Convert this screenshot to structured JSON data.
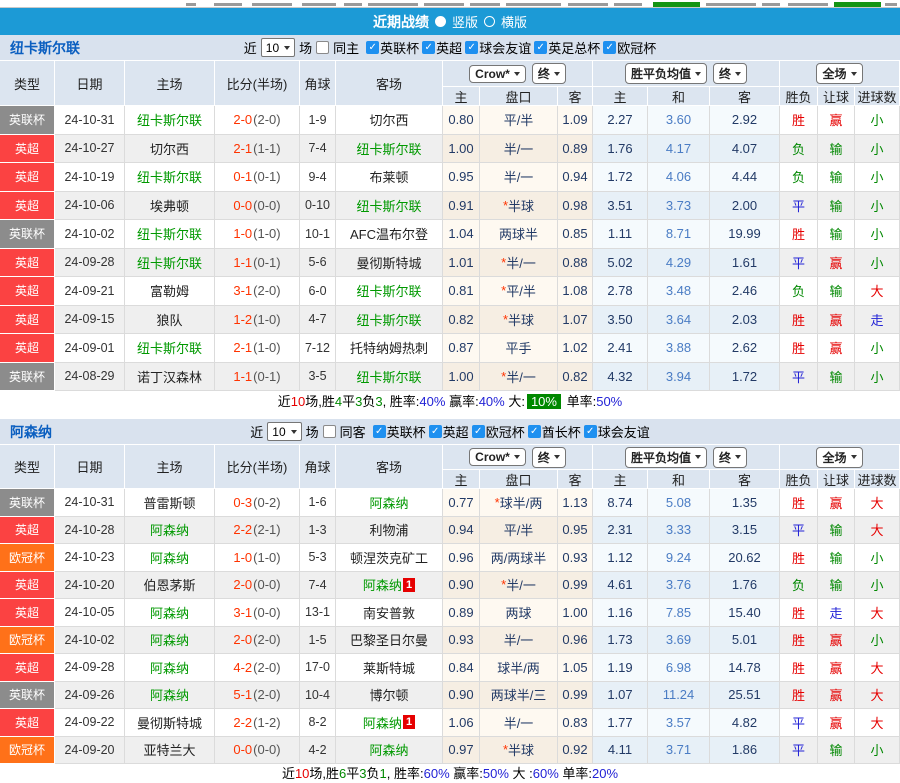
{
  "title_bar": {
    "title": "近期战绩",
    "radios": [
      {
        "label": "竖版",
        "selected": true
      },
      {
        "label": "横版",
        "selected": false
      }
    ]
  },
  "labels": {
    "near": "近",
    "matches": "场"
  },
  "columns": {
    "type": "类型",
    "date": "日期",
    "home": "主场",
    "score": "比分(半场)",
    "corner": "角球",
    "away": "客场",
    "sub": [
      "主",
      "盘口",
      "客",
      "主",
      "和",
      "客",
      "胜负",
      "让球",
      "进球数"
    ]
  },
  "dropdowns": {
    "crow": "Crow*",
    "final": "终",
    "mean": "胜平负均值",
    "scope": "全场"
  },
  "colors": {
    "title_bar_bg": "#1C9AD6",
    "section_bg": "#D9E2EE",
    "header_bg": "#DCE5F0",
    "league": {
      "英超": "#FB4242",
      "英联杯": "#8C8C8C",
      "欧冠杯": "#FF7119"
    },
    "win_red": "#E60000",
    "draw_blue": "#2222D6",
    "lose_green": "#008800",
    "team_green": "#009900",
    "score_red": "#FF3300",
    "highlight_green": "#008800",
    "checkbox_blue": "#1E90F0"
  },
  "sections": [
    {
      "team": "纽卡斯尔联",
      "count": "10",
      "same_label": "同主",
      "same_checked": false,
      "leagues": [
        "英联杯",
        "英超",
        "球会友谊",
        "英足总杯",
        "欧冠杯"
      ],
      "rows": [
        {
          "league": "英联杯",
          "date": "24-10-31",
          "home": "纽卡斯尔联",
          "home_is_team": true,
          "home_badge": "",
          "score": "2-0",
          "half": "(2-0)",
          "corner": "1-9",
          "away": "切尔西",
          "away_is_team": false,
          "away_badge": "",
          "ch": "0.80",
          "hcap": "平/半",
          "ca": "1.09",
          "mh": "2.27",
          "md": "3.60",
          "ma": "2.92",
          "res": "胜",
          "hres": "赢",
          "goal": "小"
        },
        {
          "league": "英超",
          "date": "24-10-27",
          "home": "切尔西",
          "home_is_team": false,
          "home_badge": "",
          "score": "2-1",
          "half": "(1-1)",
          "corner": "7-4",
          "away": "纽卡斯尔联",
          "away_is_team": true,
          "away_badge": "",
          "ch": "1.00",
          "hcap": "半/一",
          "ca": "0.89",
          "mh": "1.76",
          "md": "4.17",
          "ma": "4.07",
          "res": "负",
          "hres": "输",
          "goal": "小"
        },
        {
          "league": "英超",
          "date": "24-10-19",
          "home": "纽卡斯尔联",
          "home_is_team": true,
          "home_badge": "",
          "score": "0-1",
          "half": "(0-1)",
          "corner": "9-4",
          "away": "布莱顿",
          "away_is_team": false,
          "away_badge": "",
          "ch": "0.95",
          "hcap": "半/一",
          "ca": "0.94",
          "mh": "1.72",
          "md": "4.06",
          "ma": "4.44",
          "res": "负",
          "hres": "输",
          "goal": "小"
        },
        {
          "league": "英超",
          "date": "24-10-06",
          "home": "埃弗顿",
          "home_is_team": false,
          "home_badge": "",
          "score": "0-0",
          "half": "(0-0)",
          "corner": "0-10",
          "away": "纽卡斯尔联",
          "away_is_team": true,
          "away_badge": "",
          "ch": "0.91",
          "hcap": "*半球",
          "ca": "0.98",
          "mh": "3.51",
          "md": "3.73",
          "ma": "2.00",
          "res": "平",
          "hres": "输",
          "goal": "小"
        },
        {
          "league": "英联杯",
          "date": "24-10-02",
          "home": "纽卡斯尔联",
          "home_is_team": true,
          "home_badge": "",
          "score": "1-0",
          "half": "(1-0)",
          "corner": "10-1",
          "away": "AFC温布尔登",
          "away_is_team": false,
          "away_badge": "",
          "ch": "1.04",
          "hcap": "两球半",
          "ca": "0.85",
          "mh": "1.11",
          "md": "8.71",
          "ma": "19.99",
          "res": "胜",
          "hres": "输",
          "goal": "小"
        },
        {
          "league": "英超",
          "date": "24-09-28",
          "home": "纽卡斯尔联",
          "home_is_team": true,
          "home_badge": "",
          "score": "1-1",
          "half": "(0-1)",
          "corner": "5-6",
          "away": "曼彻斯特城",
          "away_is_team": false,
          "away_badge": "",
          "ch": "1.01",
          "hcap": "*半/一",
          "ca": "0.88",
          "mh": "5.02",
          "md": "4.29",
          "ma": "1.61",
          "res": "平",
          "hres": "赢",
          "goal": "小"
        },
        {
          "league": "英超",
          "date": "24-09-21",
          "home": "富勒姆",
          "home_is_team": false,
          "home_badge": "",
          "score": "3-1",
          "half": "(2-0)",
          "corner": "6-0",
          "away": "纽卡斯尔联",
          "away_is_team": true,
          "away_badge": "",
          "ch": "0.81",
          "hcap": "*平/半",
          "ca": "1.08",
          "mh": "2.78",
          "md": "3.48",
          "ma": "2.46",
          "res": "负",
          "hres": "输",
          "goal": "大"
        },
        {
          "league": "英超",
          "date": "24-09-15",
          "home": "狼队",
          "home_is_team": false,
          "home_badge": "",
          "score": "1-2",
          "half": "(1-0)",
          "corner": "4-7",
          "away": "纽卡斯尔联",
          "away_is_team": true,
          "away_badge": "",
          "ch": "0.82",
          "hcap": "*半球",
          "ca": "1.07",
          "mh": "3.50",
          "md": "3.64",
          "ma": "2.03",
          "res": "胜",
          "hres": "赢",
          "goal": "走"
        },
        {
          "league": "英超",
          "date": "24-09-01",
          "home": "纽卡斯尔联",
          "home_is_team": true,
          "home_badge": "",
          "score": "2-1",
          "half": "(1-0)",
          "corner": "7-12",
          "away": "托特纳姆热刺",
          "away_is_team": false,
          "away_badge": "",
          "ch": "0.87",
          "hcap": "平手",
          "ca": "1.02",
          "mh": "2.41",
          "md": "3.88",
          "ma": "2.62",
          "res": "胜",
          "hres": "赢",
          "goal": "小"
        },
        {
          "league": "英联杯",
          "date": "24-08-29",
          "home": "诺丁汉森林",
          "home_is_team": false,
          "home_badge": "",
          "score": "1-1",
          "half": "(0-1)",
          "corner": "3-5",
          "away": "纽卡斯尔联",
          "away_is_team": true,
          "away_badge": "",
          "ch": "1.00",
          "hcap": "*半/一",
          "ca": "0.82",
          "mh": "4.32",
          "md": "3.94",
          "ma": "1.72",
          "res": "平",
          "hres": "输",
          "goal": "小"
        }
      ],
      "summary": [
        {
          "t": "近",
          "c": "sk"
        },
        {
          "t": "10",
          "c": "sr"
        },
        {
          "t": "场,胜",
          "c": "sk"
        },
        {
          "t": "4",
          "c": "sg"
        },
        {
          "t": "平",
          "c": "sk"
        },
        {
          "t": "3",
          "c": "sg"
        },
        {
          "t": "负",
          "c": "sk"
        },
        {
          "t": "3",
          "c": "sg"
        },
        {
          "t": ", 胜率:",
          "c": "sk"
        },
        {
          "t": "40%",
          "c": "sb"
        },
        {
          "t": " 赢率:",
          "c": "sk"
        },
        {
          "t": "40%",
          "c": "sb"
        },
        {
          "t": " 大:",
          "c": "sk"
        },
        {
          "t": "10%",
          "c": "shl"
        },
        {
          "t": " 单率:",
          "c": "sk"
        },
        {
          "t": "50%",
          "c": "sb"
        }
      ]
    },
    {
      "team": "阿森纳",
      "count": "10",
      "same_label": "同客",
      "same_checked": false,
      "leagues": [
        "英联杯",
        "英超",
        "欧冠杯",
        "酋长杯",
        "球会友谊"
      ],
      "rows": [
        {
          "league": "英联杯",
          "date": "24-10-31",
          "home": "普雷斯顿",
          "home_is_team": false,
          "home_badge": "",
          "score": "0-3",
          "half": "(0-2)",
          "corner": "1-6",
          "away": "阿森纳",
          "away_is_team": true,
          "away_badge": "",
          "ch": "0.77",
          "hcap": "*球半/两",
          "ca": "1.13",
          "mh": "8.74",
          "md": "5.08",
          "ma": "1.35",
          "res": "胜",
          "hres": "赢",
          "goal": "大"
        },
        {
          "league": "英超",
          "date": "24-10-28",
          "home": "阿森纳",
          "home_is_team": true,
          "home_badge": "",
          "score": "2-2",
          "half": "(2-1)",
          "corner": "1-3",
          "away": "利物浦",
          "away_is_team": false,
          "away_badge": "",
          "ch": "0.94",
          "hcap": "平/半",
          "ca": "0.95",
          "mh": "2.31",
          "md": "3.33",
          "ma": "3.15",
          "res": "平",
          "hres": "输",
          "goal": "大"
        },
        {
          "league": "欧冠杯",
          "date": "24-10-23",
          "home": "阿森纳",
          "home_is_team": true,
          "home_badge": "",
          "score": "1-0",
          "half": "(1-0)",
          "corner": "5-3",
          "away": "顿涅茨克矿工",
          "away_is_team": false,
          "away_badge": "",
          "ch": "0.96",
          "hcap": "两/两球半",
          "ca": "0.93",
          "mh": "1.12",
          "md": "9.24",
          "ma": "20.62",
          "res": "胜",
          "hres": "输",
          "goal": "小"
        },
        {
          "league": "英超",
          "date": "24-10-20",
          "home": "伯恩茅斯",
          "home_is_team": false,
          "home_badge": "",
          "score": "2-0",
          "half": "(0-0)",
          "corner": "7-4",
          "away": "阿森纳",
          "away_is_team": true,
          "away_badge": "1",
          "ch": "0.90",
          "hcap": "*半/一",
          "ca": "0.99",
          "mh": "4.61",
          "md": "3.76",
          "ma": "1.76",
          "res": "负",
          "hres": "输",
          "goal": "小"
        },
        {
          "league": "英超",
          "date": "24-10-05",
          "home": "阿森纳",
          "home_is_team": true,
          "home_badge": "",
          "score": "3-1",
          "half": "(0-0)",
          "corner": "13-1",
          "away": "南安普敦",
          "away_is_team": false,
          "away_badge": "",
          "ch": "0.89",
          "hcap": "两球",
          "ca": "1.00",
          "mh": "1.16",
          "md": "7.85",
          "ma": "15.40",
          "res": "胜",
          "hres": "走",
          "goal": "大"
        },
        {
          "league": "欧冠杯",
          "date": "24-10-02",
          "home": "阿森纳",
          "home_is_team": true,
          "home_badge": "",
          "score": "2-0",
          "half": "(2-0)",
          "corner": "1-5",
          "away": "巴黎圣日尔曼",
          "away_is_team": false,
          "away_badge": "",
          "ch": "0.93",
          "hcap": "半/一",
          "ca": "0.96",
          "mh": "1.73",
          "md": "3.69",
          "ma": "5.01",
          "res": "胜",
          "hres": "赢",
          "goal": "小"
        },
        {
          "league": "英超",
          "date": "24-09-28",
          "home": "阿森纳",
          "home_is_team": true,
          "home_badge": "",
          "score": "4-2",
          "half": "(2-0)",
          "corner": "17-0",
          "away": "莱斯特城",
          "away_is_team": false,
          "away_badge": "",
          "ch": "0.84",
          "hcap": "球半/两",
          "ca": "1.05",
          "mh": "1.19",
          "md": "6.98",
          "ma": "14.78",
          "res": "胜",
          "hres": "赢",
          "goal": "大"
        },
        {
          "league": "英联杯",
          "date": "24-09-26",
          "home": "阿森纳",
          "home_is_team": true,
          "home_badge": "",
          "score": "5-1",
          "half": "(2-0)",
          "corner": "10-4",
          "away": "博尔顿",
          "away_is_team": false,
          "away_badge": "",
          "ch": "0.90",
          "hcap": "两球半/三",
          "ca": "0.99",
          "mh": "1.07",
          "md": "11.24",
          "ma": "25.51",
          "res": "胜",
          "hres": "赢",
          "goal": "大"
        },
        {
          "league": "英超",
          "date": "24-09-22",
          "home": "曼彻斯特城",
          "home_is_team": false,
          "home_badge": "",
          "score": "2-2",
          "half": "(1-2)",
          "corner": "8-2",
          "away": "阿森纳",
          "away_is_team": true,
          "away_badge": "1",
          "ch": "1.06",
          "hcap": "半/一",
          "ca": "0.83",
          "mh": "1.77",
          "md": "3.57",
          "ma": "4.82",
          "res": "平",
          "hres": "赢",
          "goal": "大"
        },
        {
          "league": "欧冠杯",
          "date": "24-09-20",
          "home": "亚特兰大",
          "home_is_team": false,
          "home_badge": "",
          "score": "0-0",
          "half": "(0-0)",
          "corner": "4-2",
          "away": "阿森纳",
          "away_is_team": true,
          "away_badge": "",
          "ch": "0.97",
          "hcap": "*半球",
          "ca": "0.92",
          "mh": "4.11",
          "md": "3.71",
          "ma": "1.86",
          "res": "平",
          "hres": "输",
          "goal": "小"
        }
      ],
      "summary": [
        {
          "t": "近",
          "c": "sk"
        },
        {
          "t": "10",
          "c": "sr"
        },
        {
          "t": "场,胜",
          "c": "sk"
        },
        {
          "t": "6",
          "c": "sg"
        },
        {
          "t": "平",
          "c": "sk"
        },
        {
          "t": "3",
          "c": "sg"
        },
        {
          "t": "负",
          "c": "sk"
        },
        {
          "t": "1",
          "c": "sg"
        },
        {
          "t": ", 胜率:",
          "c": "sk"
        },
        {
          "t": "60%",
          "c": "sb"
        },
        {
          "t": " 赢率:",
          "c": "sk"
        },
        {
          "t": "50%",
          "c": "sb"
        },
        {
          "t": " 大 :",
          "c": "sk"
        },
        {
          "t": "60%",
          "c": "sb"
        },
        {
          "t": " 单率:",
          "c": "sk"
        },
        {
          "t": "20%",
          "c": "sb"
        }
      ]
    }
  ]
}
